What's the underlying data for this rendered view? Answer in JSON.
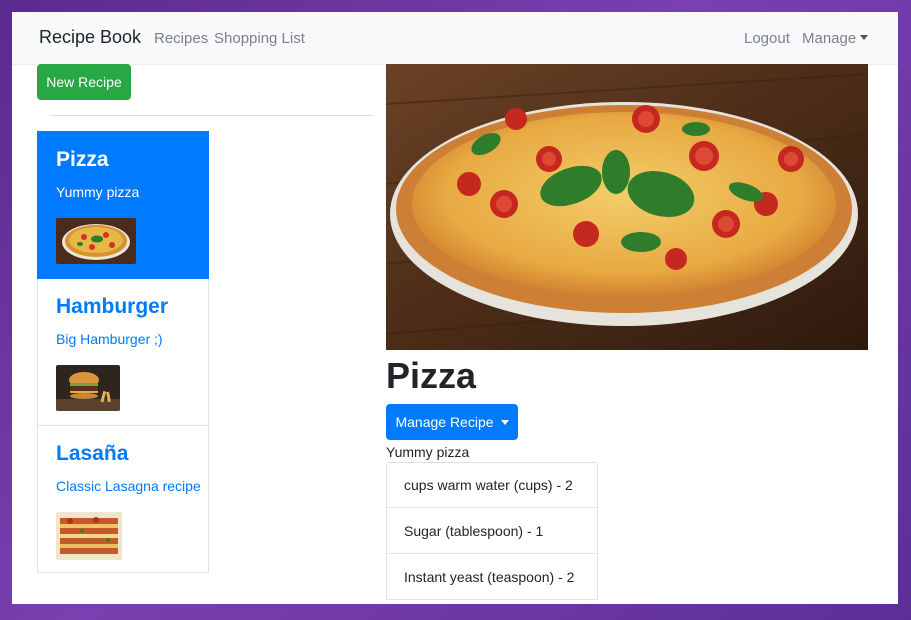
{
  "navbar": {
    "brand": "Recipe Book",
    "links": [
      "Recipes",
      "Shopping List"
    ],
    "logout": "Logout",
    "manage": "Manage"
  },
  "sidebar": {
    "new_recipe": "New Recipe",
    "recipes": [
      {
        "name": "Pizza",
        "description": "Yummy pizza",
        "active": true
      },
      {
        "name": "Hamburger",
        "description": "Big Hamburger ;)",
        "active": false
      },
      {
        "name": "Lasaña",
        "description": "Classic Lasagna recipe",
        "active": false
      }
    ]
  },
  "detail": {
    "title": "Pizza",
    "manage_button": "Manage Recipe",
    "description": "Yummy pizza",
    "ingredients": [
      "cups warm water (cups) - 2",
      "Sugar (tablespoon) - 1",
      "Instant yeast (teaspoon) - 2"
    ]
  },
  "colors": {
    "primary": "#007bff",
    "success": "#28a745",
    "navbar_bg": "#f8f9fa",
    "backdrop": "#6a35a0"
  }
}
